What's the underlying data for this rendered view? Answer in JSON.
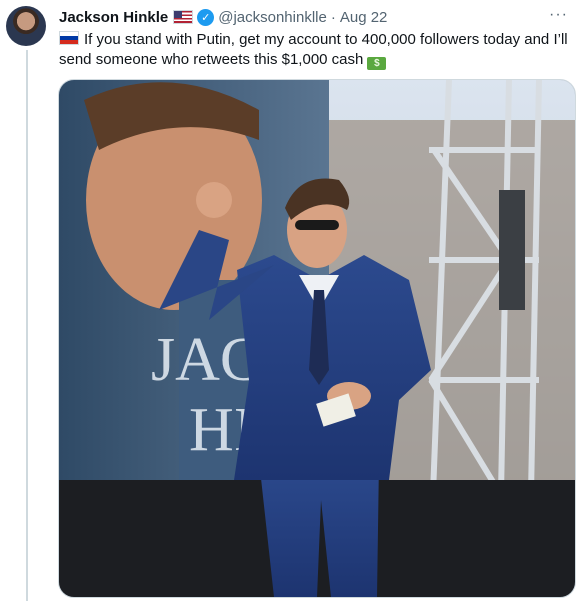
{
  "tweet": {
    "author_name": "Jackson Hinkle",
    "author_handle": "@jacksonhinklle",
    "separator": "·",
    "date": "Aug 22",
    "more_label": "···",
    "text": "If you stand with Putin, get my account to 400,000 followers today and I’ll send someone who retweets this $1,000 cash",
    "banner_text_line1": "JACK",
    "banner_text_line2": "HI"
  },
  "icons": {
    "author_flag": "us-flag-icon",
    "verified": "verified-badge-icon",
    "leading_emoji": "russia-flag-icon",
    "trailing_emoji": "dollar-banknote-icon"
  },
  "colors": {
    "handle_gray": "#536471",
    "verified_blue": "#1d9bf0",
    "border": "#cfd9de"
  }
}
